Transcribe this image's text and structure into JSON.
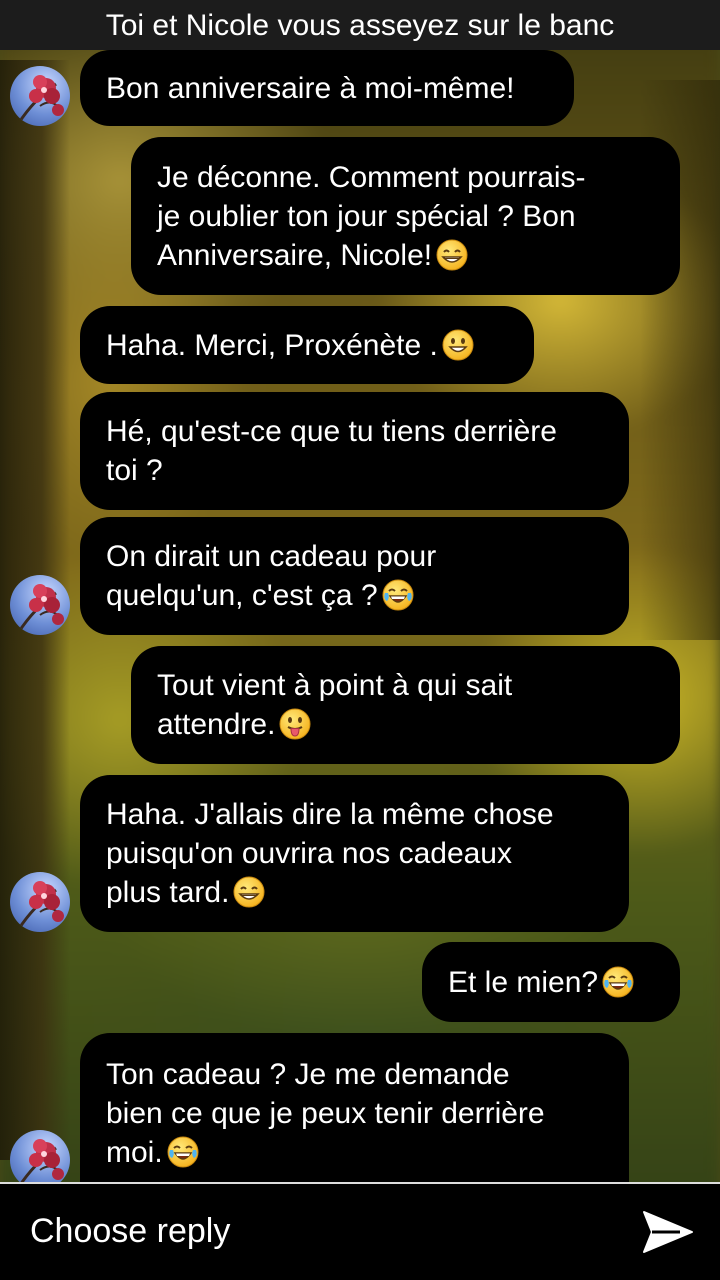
{
  "header": {
    "title": "Toi et Nicole vous asseyez sur le banc"
  },
  "messages": [
    {
      "text": "Bon anniversaire à moi-même!",
      "emoji": ""
    },
    {
      "text": "Je déconne. Comment pourrais-\nje oublier ton jour spécial ? Bon\nAnniversaire, Nicole!",
      "emoji": "grinning-face-with-smiling-eyes"
    },
    {
      "text": "Haha. Merci, Proxénète .",
      "emoji": "grinning-face"
    },
    {
      "text": "Hé, qu'est-ce que tu tiens derrière\ntoi ?",
      "emoji": ""
    },
    {
      "text": "On dirait un cadeau pour\nquelqu'un, c'est ça ?",
      "emoji": "face-with-tears-of-joy"
    },
    {
      "text": "Tout vient à point à qui sait\nattendre.",
      "emoji": "face-with-tongue"
    },
    {
      "text": "Haha. J'allais dire la même chose\npuisqu'on ouvrira nos cadeaux\nplus tard.",
      "emoji": "grinning-face-with-smiling-eyes"
    },
    {
      "text": "Et le mien?",
      "emoji": "face-with-tears-of-joy"
    },
    {
      "text": "Ton cadeau ? Je me demande\nbien ce que je peux tenir derrière\nmoi.",
      "emoji": "face-with-tears-of-joy"
    }
  ],
  "avatar": {
    "icon": "flower-avatar-icon"
  },
  "reply": {
    "label": "Choose reply",
    "send_icon": "send-arrow-icon"
  },
  "colors": {
    "bubble": "#000000",
    "text": "#ffffff",
    "topbar": "#1c1c1c"
  }
}
